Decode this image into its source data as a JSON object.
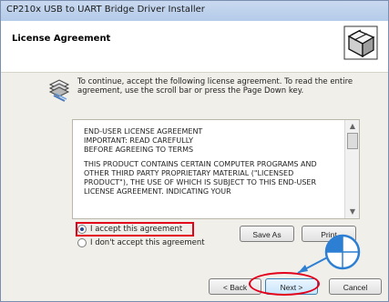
{
  "window": {
    "title": "CP210x USB to UART Bridge Driver Installer"
  },
  "header": {
    "title": "License Agreement",
    "icon": "installer-box-icon"
  },
  "intro": {
    "text": "To continue, accept the following license agreement. To read the entire agreement, use the scroll bar or press the Page Down key."
  },
  "license": {
    "p1": "END-USER LICENSE AGREEMENT\nIMPORTANT: READ CAREFULLY\nBEFORE AGREEING TO TERMS",
    "p2": "THIS PRODUCT CONTAINS CERTAIN COMPUTER PROGRAMS AND OTHER THIRD PARTY PROPRIETARY MATERIAL (\"LICENSED PRODUCT\"), THE USE OF WHICH IS SUBJECT TO THIS END-USER LICENSE AGREEMENT. INDICATING YOUR"
  },
  "options": {
    "accept": "I accept this agreement",
    "decline": "I don't accept this agreement",
    "selected": "accept"
  },
  "buttons": {
    "save_as": "Save As",
    "print": "Print",
    "back": "< Back",
    "next": "Next >",
    "cancel": "Cancel"
  },
  "colors": {
    "highlight": "#e2001a",
    "pointer_blue": "#2d7fd3"
  }
}
